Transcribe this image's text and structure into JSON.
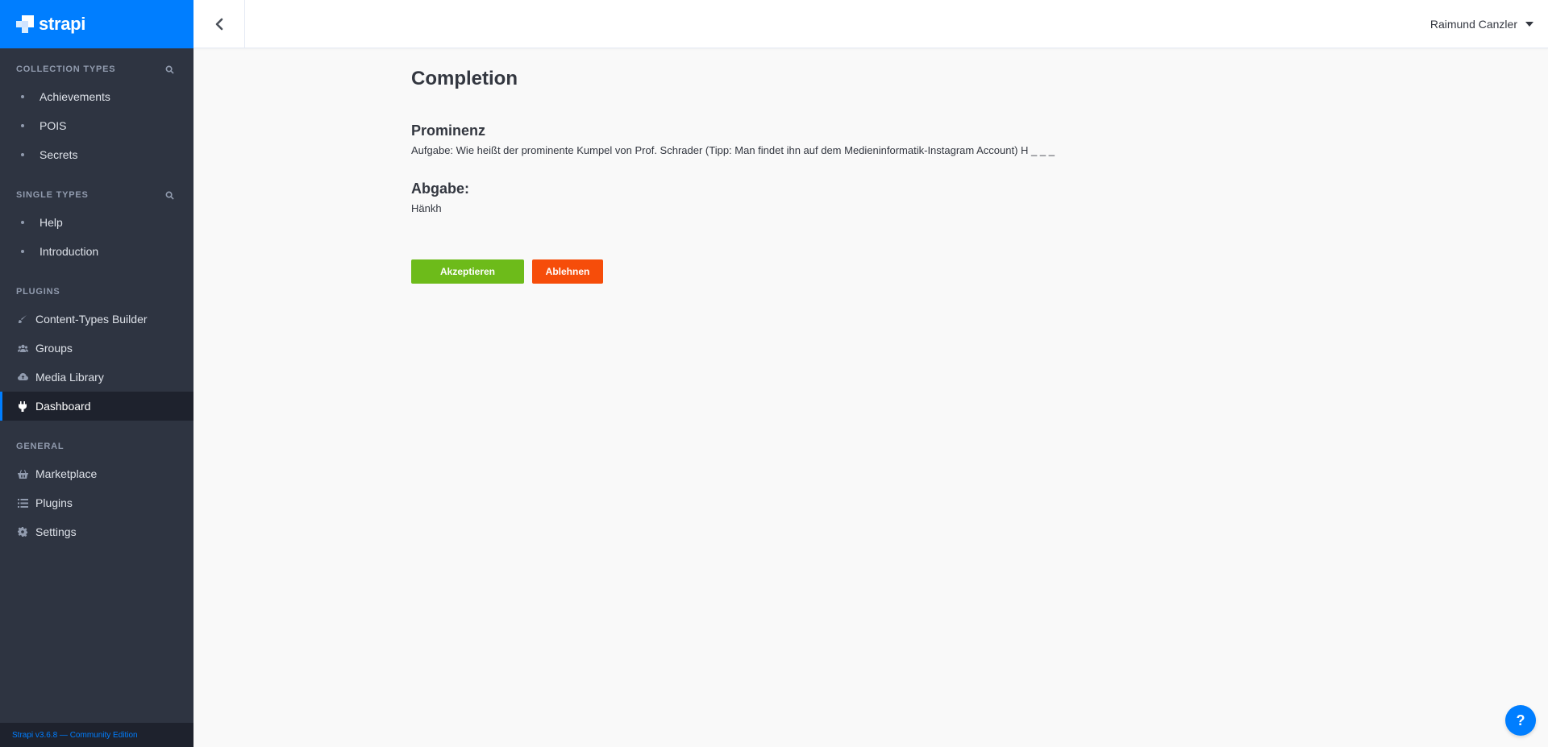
{
  "brand": {
    "name": "strapi"
  },
  "sidebar": {
    "collection_types": {
      "title": "Collection Types",
      "items": [
        {
          "label": "Achievements"
        },
        {
          "label": "POIS"
        },
        {
          "label": "Secrets"
        }
      ]
    },
    "single_types": {
      "title": "Single Types",
      "items": [
        {
          "label": "Help"
        },
        {
          "label": "Introduction"
        }
      ]
    },
    "plugins": {
      "title": "Plugins",
      "items": [
        {
          "label": "Content-Types Builder",
          "icon": "brush-icon"
        },
        {
          "label": "Groups",
          "icon": "users-icon"
        },
        {
          "label": "Media Library",
          "icon": "cloud-upload-icon"
        },
        {
          "label": "Dashboard",
          "icon": "plug-icon",
          "active": true
        }
      ]
    },
    "general": {
      "title": "General",
      "items": [
        {
          "label": "Marketplace",
          "icon": "shopping-basket-icon"
        },
        {
          "label": "Plugins",
          "icon": "list-icon"
        },
        {
          "label": "Settings",
          "icon": "gear-icon"
        }
      ]
    },
    "version": "Strapi v3.6.8 — Community Edition"
  },
  "header": {
    "user_name": "Raimund Canzler"
  },
  "main": {
    "title": "Completion",
    "task_title": "Prominenz",
    "task_text": "Aufgabe: Wie heißt der prominente Kumpel von Prof. Schrader (Tipp: Man findet ihn auf dem Medieninformatik-Instagram Account) H _ _ _",
    "submission_title": "Abgabe:",
    "submission_text": "Hänkh",
    "accept_label": "Akzeptieren",
    "reject_label": "Ablehnen"
  },
  "help": {
    "label": "?"
  },
  "colors": {
    "accent": "#007eff",
    "sidebar_bg": "#2e3441",
    "accept": "#6dbb1a",
    "reject": "#f64d0a"
  }
}
